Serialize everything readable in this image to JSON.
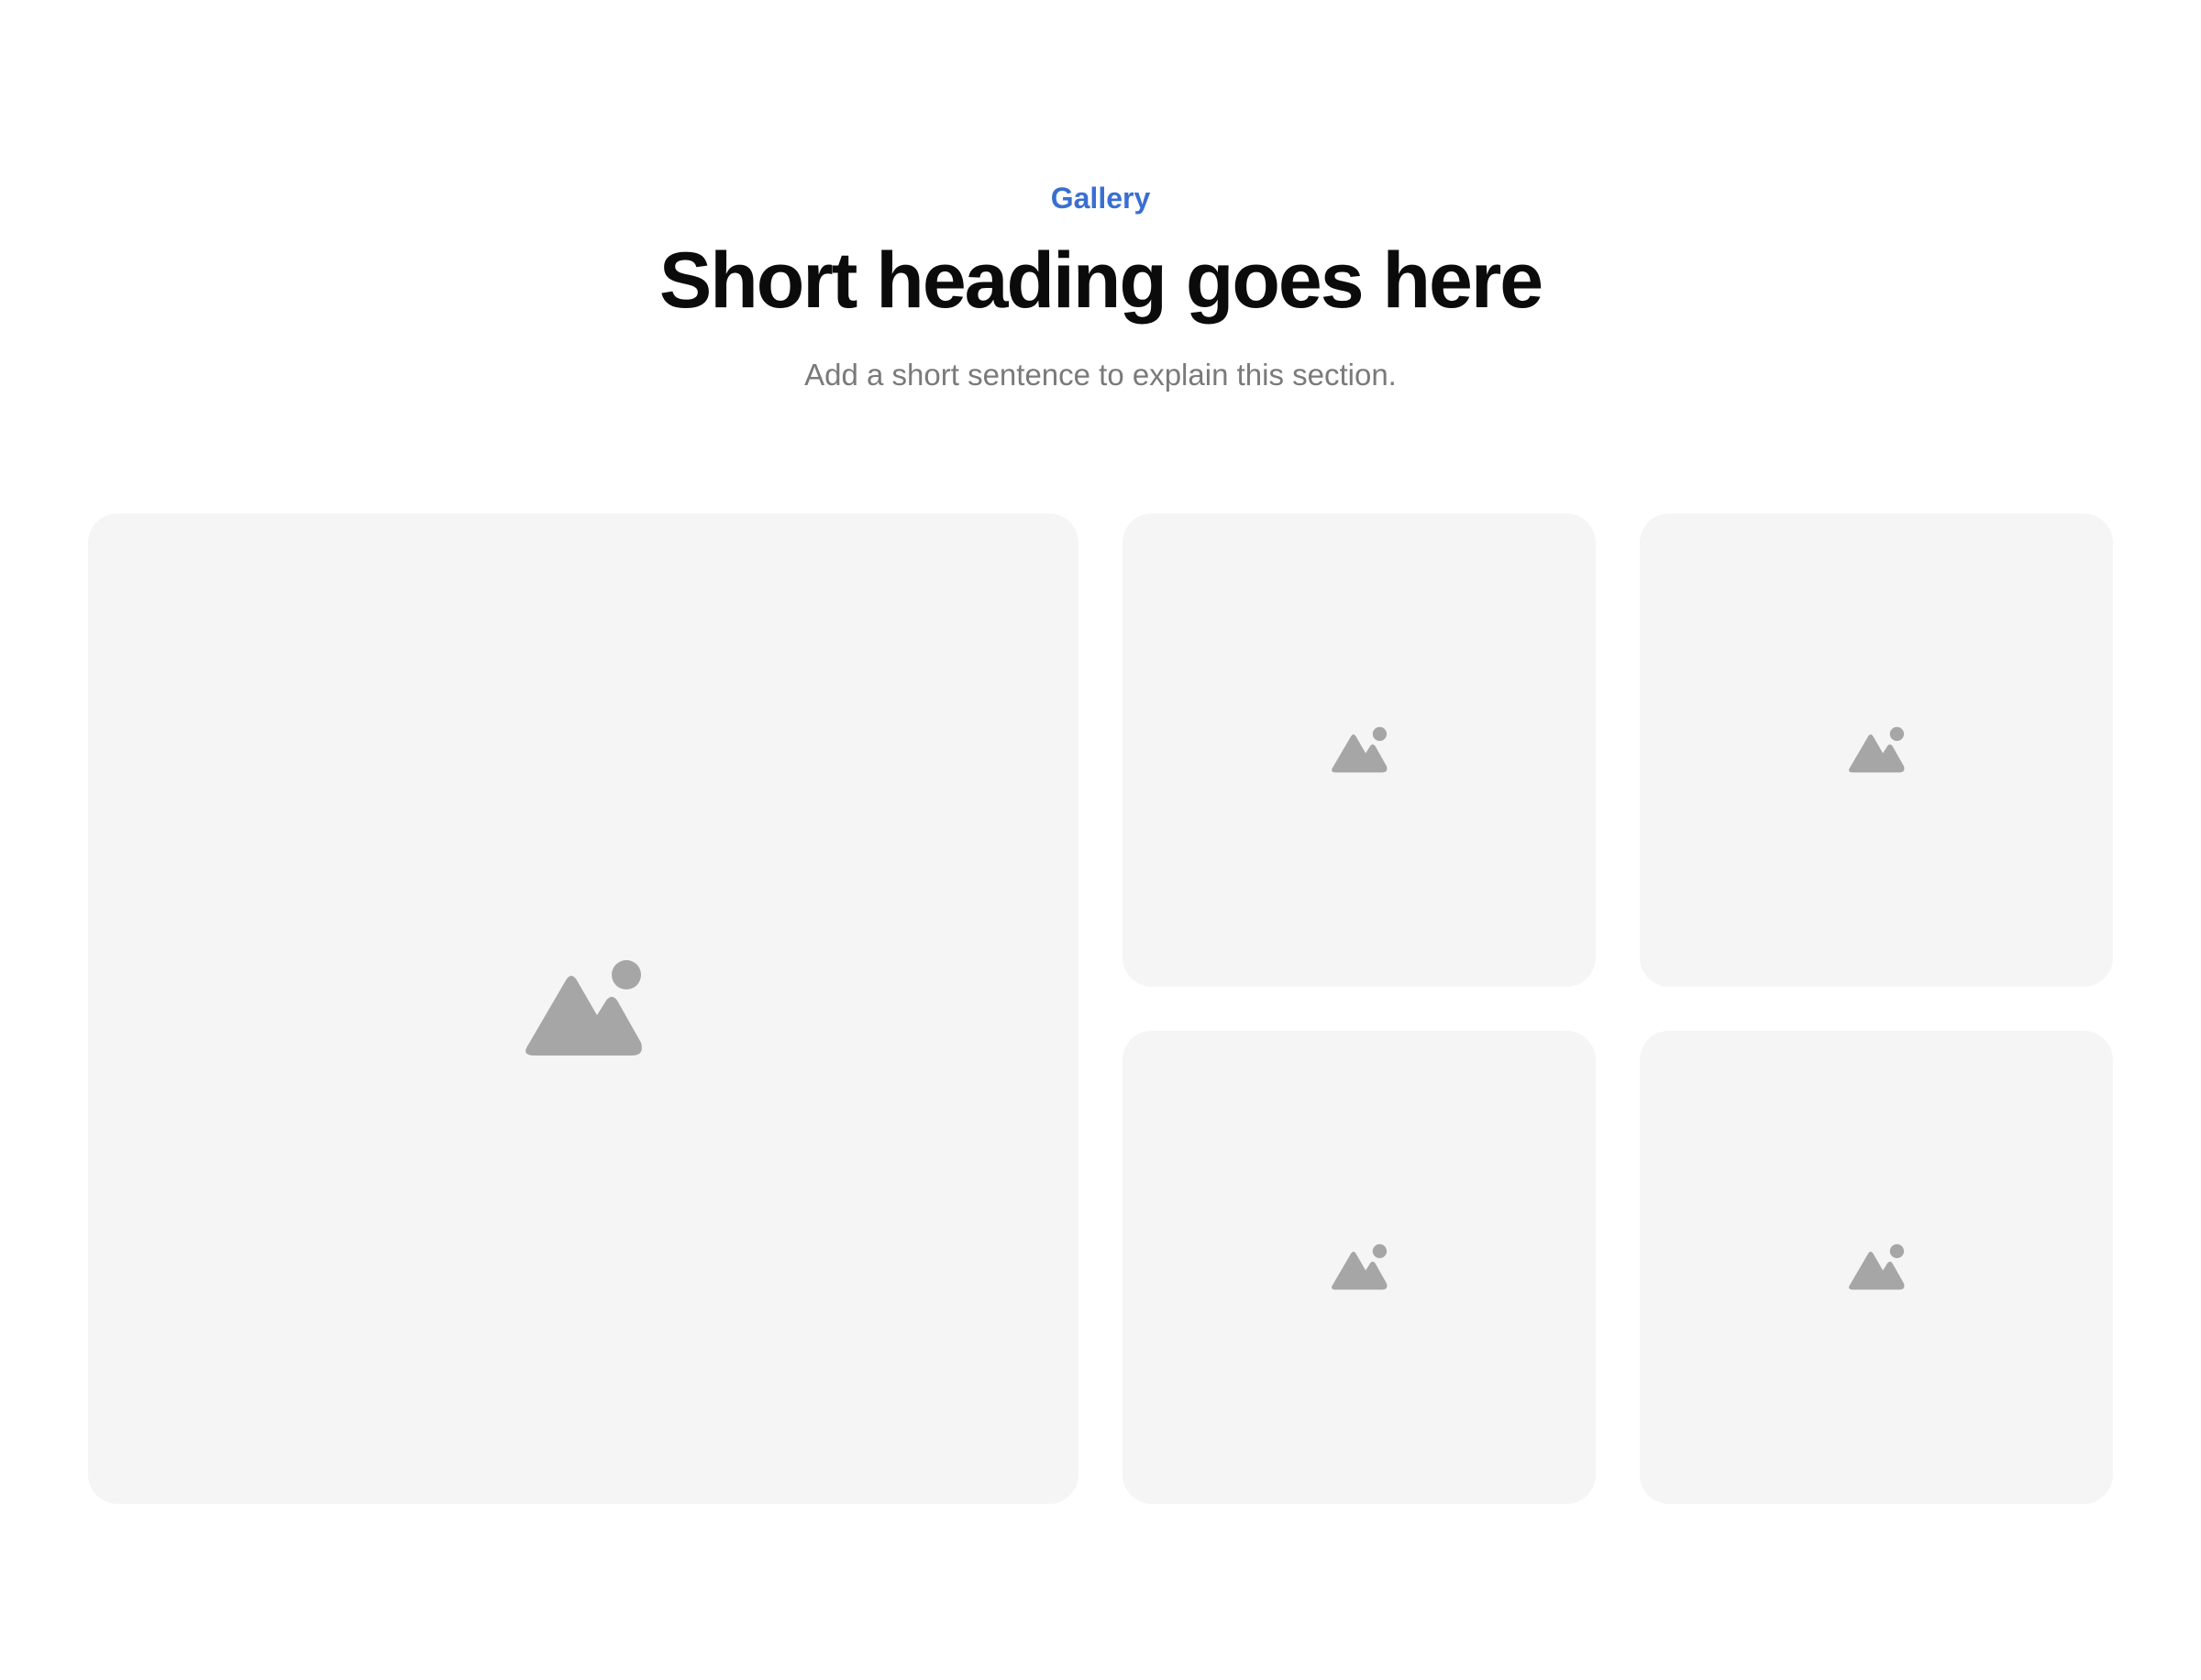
{
  "header": {
    "eyebrow": "Gallery",
    "title": "Short heading goes here",
    "subtitle": "Add a short sentence to explain this section."
  },
  "gallery": {
    "tiles": [
      {
        "icon": "image-placeholder-icon"
      },
      {
        "icon": "image-placeholder-icon"
      },
      {
        "icon": "image-placeholder-icon"
      },
      {
        "icon": "image-placeholder-icon"
      },
      {
        "icon": "image-placeholder-icon"
      }
    ]
  },
  "colors": {
    "accent": "#3a6fd0",
    "heading": "#0b0b0b",
    "muted": "#7a7a7a",
    "tile_background": "#f5f5f5",
    "icon": "#a6a6a6"
  }
}
